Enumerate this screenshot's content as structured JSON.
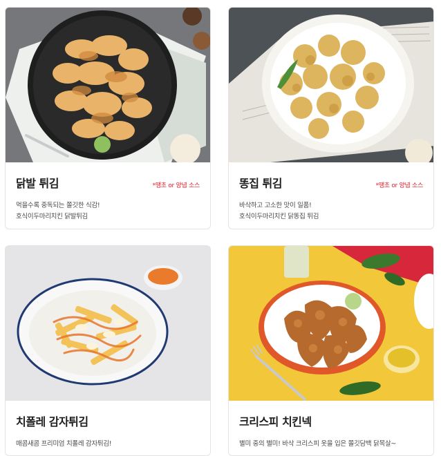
{
  "menu_items": [
    {
      "image": "fried-chicken-feet-on-black-plate",
      "title": "닭발 튀김",
      "badge": "*땡초 or 양념 소스",
      "lines": [
        "먹을수록 중독되는 쫄깃한 식감!",
        "호식이두마리치킨 닭발튀김"
      ]
    },
    {
      "image": "fried-chicken-gizzards-on-white-plate",
      "title": "똥집 튀김",
      "badge": "*땡초 or 양념 소스",
      "lines": [
        "바삭하고 고소한 맛이 일품!",
        "호식이두마리치킨 닭똥집 튀김"
      ]
    },
    {
      "image": "cheese-potato-fries-in-bowl",
      "title": "치폴레 감자튀김",
      "badge": "",
      "lines": [
        "매콤새콤 프리미엄 치폴레 감자튀김!"
      ]
    },
    {
      "image": "crispy-chicken-neck-on-plate",
      "title": "크리스피 치킨넥",
      "badge": "",
      "lines": [
        "별미 중의 별미! 바삭 크리스피 옷을 입은 쫄깃담백 닭목살~"
      ]
    }
  ]
}
